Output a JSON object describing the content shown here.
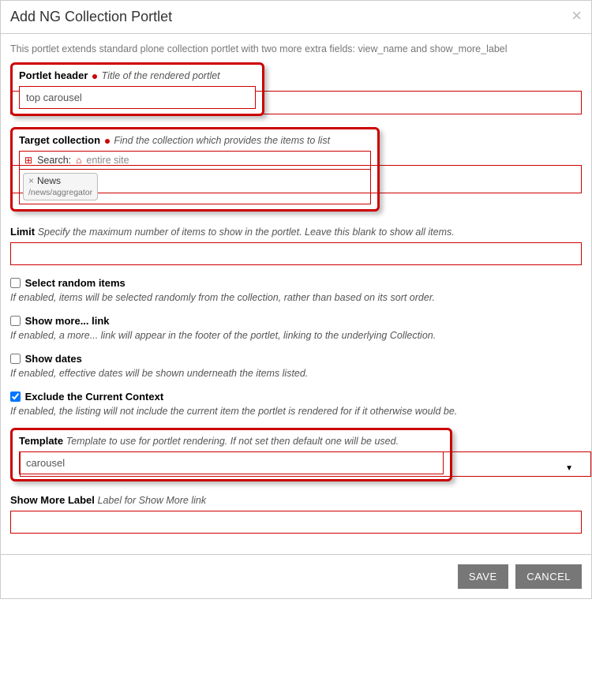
{
  "dialog": {
    "title": "Add NG Collection Portlet",
    "intro": "This portlet extends standard plone collection portlet with two more extra fields: view_name and show_more_label"
  },
  "portlet_header": {
    "label": "Portlet header",
    "help": "Title of the rendered portlet",
    "value": "top carousel"
  },
  "target_collection": {
    "label": "Target collection",
    "help": "Find the collection which provides the items to list",
    "search_label": "Search:",
    "scope": "entire site",
    "selected_title": "News",
    "selected_path": "/news/aggregator"
  },
  "limit": {
    "label": "Limit",
    "help": "Specify the maximum number of items to show in the portlet. Leave this blank to show all items.",
    "value": ""
  },
  "random": {
    "label": "Select random items",
    "help": "If enabled, items will be selected randomly from the collection, rather than based on its sort order.",
    "checked": false
  },
  "show_more": {
    "label": "Show more... link",
    "help": "If enabled, a more... link will appear in the footer of the portlet, linking to the underlying Collection.",
    "checked": false
  },
  "show_dates": {
    "label": "Show dates",
    "help": "If enabled, effective dates will be shown underneath the items listed.",
    "checked": false
  },
  "exclude_context": {
    "label": "Exclude the Current Context",
    "help": "If enabled, the listing will not include the current item the portlet is rendered for if it otherwise would be.",
    "checked": true
  },
  "template": {
    "label": "Template",
    "help": "Template to use for portlet rendering. If not set then default one will be used.",
    "value": "carousel"
  },
  "show_more_label": {
    "label": "Show More Label",
    "help": "Label for Show More link",
    "value": ""
  },
  "buttons": {
    "save": "SAVE",
    "cancel": "CANCEL"
  }
}
